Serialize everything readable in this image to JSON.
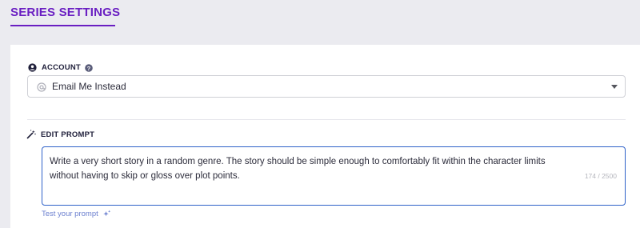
{
  "header": {
    "title": "SERIES SETTINGS"
  },
  "account": {
    "label": "ACCOUNT",
    "selected_value": "Email Me Instead"
  },
  "prompt": {
    "label": "EDIT PROMPT",
    "text": "Write a very short story in a random genre. The story should be simple enough to comfortably fit within the character limits without having to skip or gloss over plot points.",
    "char_count": "174 / 2500",
    "test_link": "Test your prompt"
  },
  "icons": {
    "account": "user-circle-icon",
    "help": "question-circle-icon",
    "select_prefix": "at-sign-icon",
    "select_caret": "caret-down-icon",
    "edit_prompt": "magic-wand-icon",
    "test": "sparkle-icon"
  },
  "colors": {
    "accent": "#6a1fc2",
    "focus_border": "#2f62c9",
    "link": "#6b7fcf",
    "page_bg": "#ebebf0"
  }
}
